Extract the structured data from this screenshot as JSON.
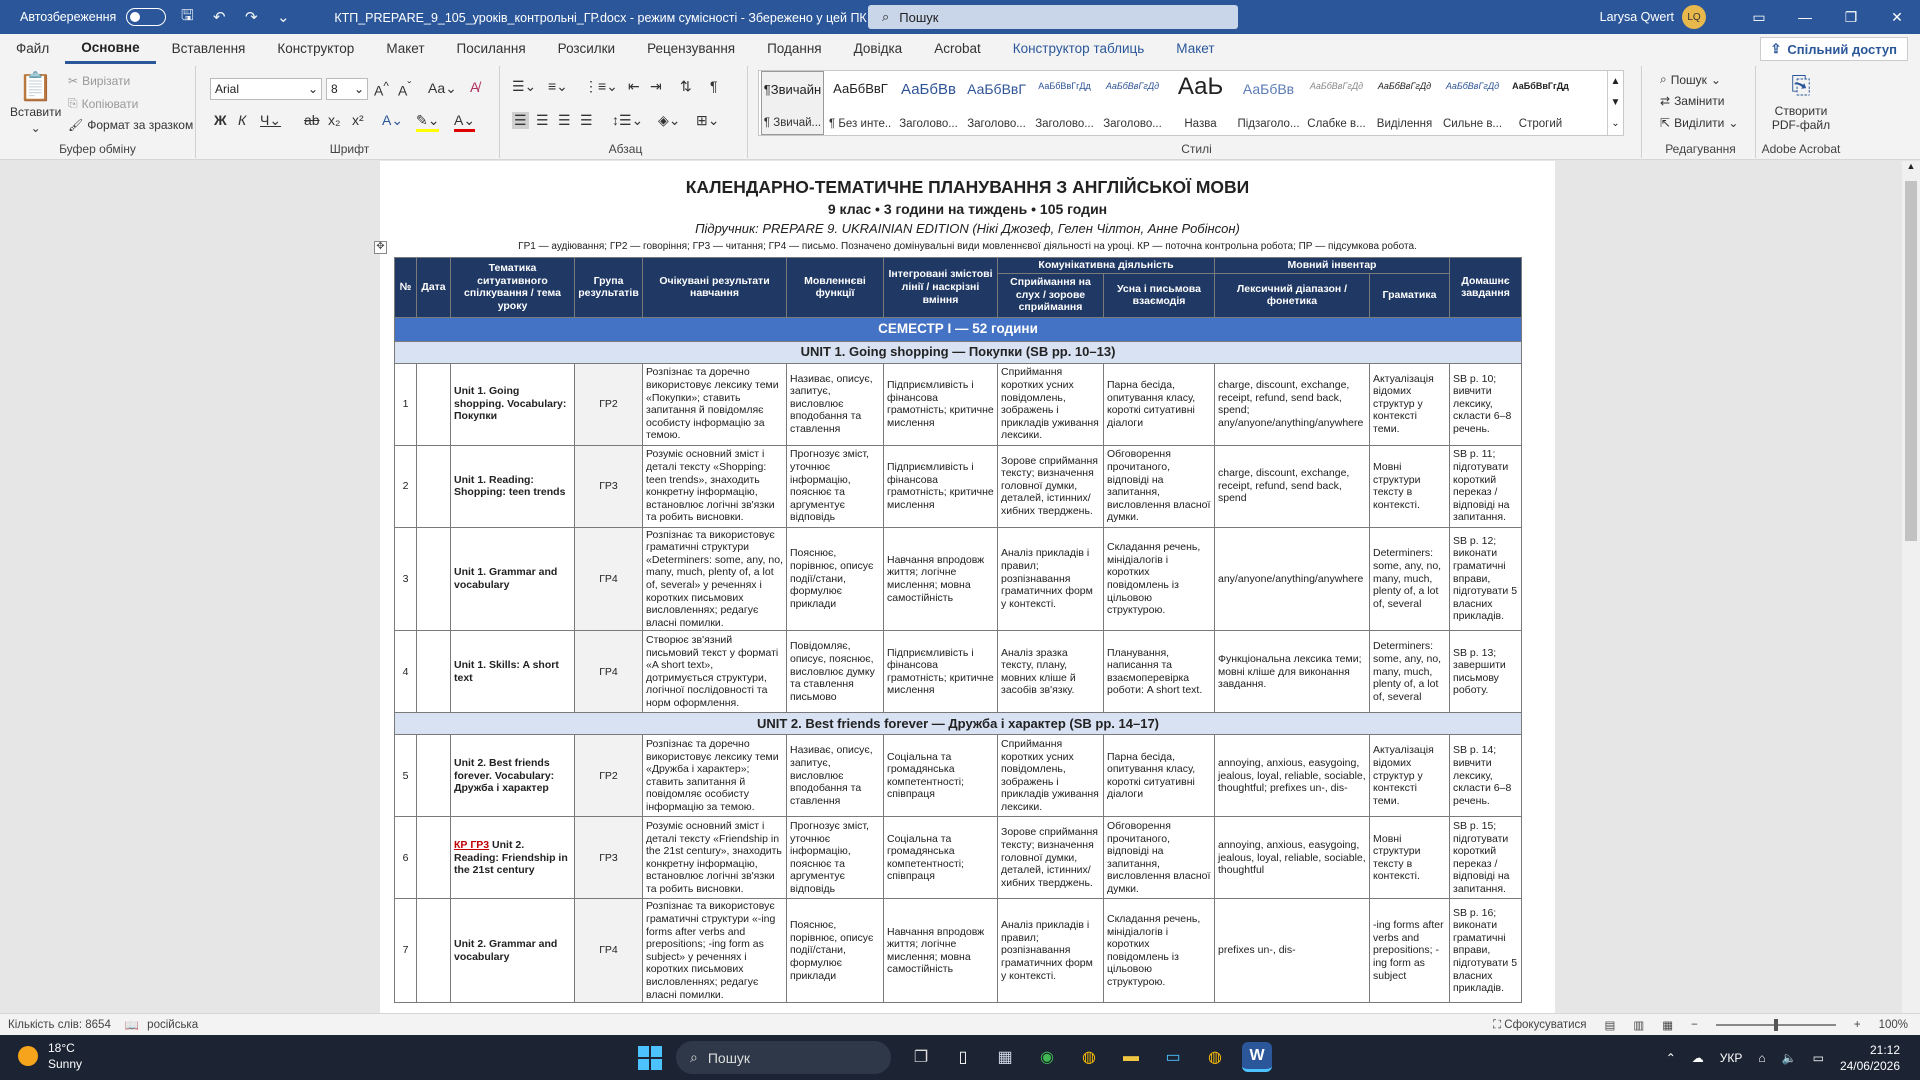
{
  "titlebar": {
    "autosave": "Автозбереження",
    "doc_title": "КТП_PREPARE_9_105_уроків_контрольні_ГР.docx  -  режим сумісності  -  Збережено у цей ПК  ⌄",
    "search": "Пошук",
    "user": "Larysa Qwert",
    "initials": "LQ"
  },
  "menu": {
    "tabs": [
      "Файл",
      "Основне",
      "Вставлення",
      "Конструктор",
      "Макет",
      "Посилання",
      "Розсилки",
      "Рецензування",
      "Подання",
      "Довідка",
      "Acrobat",
      "Конструктор таблиць",
      "Макет"
    ],
    "share": "Спільний доступ"
  },
  "ribbon": {
    "clipboard": {
      "label": "Буфер обміну",
      "paste": "Вставити",
      "cut": "Вирізати",
      "copy": "Копіювати",
      "format_painter": "Формат за зразком"
    },
    "font": {
      "label": "Шрифт",
      "family": "Arial",
      "size": "8"
    },
    "paragraph": {
      "label": "Абзац"
    },
    "styles": {
      "label": "Стилі",
      "items": [
        {
          "sample": "¶Звичайн",
          "name": "¶ Звичай..."
        },
        {
          "sample": "АаБбВвГ",
          "name": "¶ Без инте..."
        },
        {
          "sample": "АаБбВв",
          "name": "Заголово..."
        },
        {
          "sample": "АаБбВвГ",
          "name": "Заголово..."
        },
        {
          "sample": "АаБбВвГгДд",
          "name": "Заголово..."
        },
        {
          "sample": "АаБбВвГгДд",
          "name": "Заголово..."
        },
        {
          "sample": "АаЬ",
          "name": "Назва"
        },
        {
          "sample": "АаБбВв",
          "name": "Підзаголо..."
        },
        {
          "sample": "АаБбВвГгДд",
          "name": "Слабке в..."
        },
        {
          "sample": "АаБбВвГгДд",
          "name": "Виділення"
        },
        {
          "sample": "АаБбВвГгДд",
          "name": "Сильне в..."
        },
        {
          "sample": "АаБбВвГгДд",
          "name": "Строгий"
        }
      ]
    },
    "editing": {
      "label": "Редагування",
      "find": "Пошук",
      "replace": "Замінити",
      "select": "Виділити"
    },
    "acrobat": {
      "label": "Adobe Acrobat",
      "create_pdf": "Створити PDF-файл"
    }
  },
  "document": {
    "title": "КАЛЕНДАРНО-ТЕМАТИЧНЕ ПЛАНУВАННЯ З АНГЛІЙСЬКОЇ МОВИ",
    "subtitle": "9 клас • 3 години на тиждень • 105 годин",
    "textbook": "Підручник: PREPARE 9. UKRAINIAN EDITION (Нікі Джозеф, Гелен Чілтон, Анне Робінсон)",
    "legend": "ГР1 — аудіювання; ГР2 — говоріння; ГР3 — читання; ГР4 — письмо. Позначено домінувальні види мовленнєвої діяльності на уроці. КР — поточна контрольна робота; ПР — підсумкова робота.",
    "headers": {
      "no": "№",
      "date": "Дата",
      "topic": "Тематика ситуативного спілкування / тема уроку",
      "group": "Група результатів",
      "outcomes": "Очікувані результати навчання",
      "functions": "Мовленнєві функції",
      "integrated": "Інтегровані змістові лінії / наскрізні вміння",
      "comm": "Комунікативна діяльність",
      "listening": "Сприймання на слух / зорове сприймання",
      "oral": "Усна і письмова взаємодія",
      "lang": "Мовний інвентар",
      "lexis": "Лексичний діапазон / фонетика",
      "grammar": "Граматика",
      "homework": "Домашнє завдання"
    },
    "semester": "СЕМЕСТР І — 52 години",
    "unit1": "UNIT 1. Going shopping — Покупки (SB pp. 10–13)",
    "unit2": "UNIT 2. Best friends forever — Дружба і характер (SB pp. 14–17)",
    "rows": [
      {
        "no": "1",
        "kr": "",
        "topic": "Unit 1. Going shopping. Vocabulary: Покупки",
        "grp": "ГР2",
        "out": "Розпізнає та доречно використовує лексику теми «Покупки»; ставить запитання й повідомляє особисту інформацію за темою.",
        "func": "Називає, описує, запитує, висловлює вподобання та ставлення",
        "integ": "Підприємливість і фінансова грамотність; критичне мислення",
        "listen": "Сприймання коротких усних повідомлень, зображень і прикладів уживання лексики.",
        "oral": "Парна бесіда, опитування класу, короткі ситуативні діалоги",
        "lex": "charge, discount, exchange, receipt, refund, send back, spend; any/anyone/anything/anywhere",
        "gram": "Актуалізація відомих структур у контексті теми.",
        "hw": "SB p. 10; вивчити лексику, скласти 6–8 речень."
      },
      {
        "no": "2",
        "kr": "",
        "topic": "Unit 1. Reading: Shopping: teen trends",
        "grp": "ГР3",
        "out": "Розуміє основний зміст і деталі тексту «Shopping: teen trends», знаходить конкретну інформацію, встановлює логічні зв'язки та робить висновки.",
        "func": "Прогнозує зміст, уточнює інформацію, пояснює та аргументує відповідь",
        "integ": "Підприємливість і фінансова грамотність; критичне мислення",
        "listen": "Зорове сприймання тексту; визначення головної думки, деталей, істинних/хибних тверджень.",
        "oral": "Обговорення прочитаного, відповіді на запитання, висловлення власної думки.",
        "lex": "charge, discount, exchange, receipt, refund, send back, spend",
        "gram": "Мовні структури тексту в контексті.",
        "hw": "SB p. 11; підготувати короткий переказ / відповіді на запитання."
      },
      {
        "no": "3",
        "kr": "",
        "topic": "Unit 1. Grammar and vocabulary",
        "grp": "ГР4",
        "out": "Розпізнає та використовує граматичні структури «Determiners: some, any, no, many, much, plenty of, a lot of, several» у реченнях і коротких письмових висловленнях; редагує власні помилки.",
        "func": "Пояснює, порівнює, описує події/стани, формулює приклади",
        "integ": "Навчання впродовж життя; логічне мислення; мовна самостійність",
        "listen": "Аналіз прикладів і правил; розпізнавання граматичних форм у контексті.",
        "oral": "Складання речень, мінідіалогів і коротких повідомлень із цільовою структурою.",
        "lex": "any/anyone/anything/anywhere",
        "gram": "Determiners: some, any, no, many, much, plenty of, a lot of, several",
        "hw": "SB p. 12; виконати граматичні вправи, підготувати 5 власних прикладів."
      },
      {
        "no": "4",
        "kr": "",
        "topic": "Unit 1. Skills: A short text",
        "grp": "ГР4",
        "out": "Створює зв'язний письмовий текст у форматі «A short text», дотримується структури, логічної послідовності та норм оформлення.",
        "func": "Повідомляє, описує, пояснює, висловлює думку та ставлення письмово",
        "integ": "Підприємливість і фінансова грамотність; критичне мислення",
        "listen": "Аналіз зразка тексту, плану, мовних кліше й засобів зв'язку.",
        "oral": "Планування, написання та взаємоперевірка роботи: A short text.",
        "lex": "Функціональна лексика теми; мовні кліше для виконання завдання.",
        "gram": "Determiners: some, any, no, many, much, plenty of, a lot of, several",
        "hw": "SB p. 13; завершити письмову роботу."
      },
      {
        "no": "5",
        "kr": "",
        "topic": "Unit 2. Best friends forever. Vocabulary: Дружба і характер",
        "grp": "ГР2",
        "out": "Розпізнає та доречно використовує лексику теми «Дружба і характер»; ставить запитання й повідомляє особисту інформацію за темою.",
        "func": "Називає, описує, запитує, висловлює вподобання та ставлення",
        "integ": "Соціальна та громадянська компетентності; співпраця",
        "listen": "Сприймання коротких усних повідомлень, зображень і прикладів уживання лексики.",
        "oral": "Парна бесіда, опитування класу, короткі ситуативні діалоги",
        "lex": "annoying, anxious, easygoing, jealous, loyal, reliable, sociable, thoughtful; prefixes un-, dis-",
        "gram": "Актуалізація відомих структур у контексті теми.",
        "hw": "SB p. 14; вивчити лексику, скласти 6–8 речень."
      },
      {
        "no": "6",
        "kr": "КР ГР3",
        "topic": "Unit 2. Reading: Friendship in the 21st century",
        "grp": "ГР3",
        "out": "Розуміє основний зміст і деталі тексту «Friendship in the 21st century», знаходить конкретну інформацію, встановлює логічні зв'язки та робить висновки.",
        "func": "Прогнозує зміст, уточнює інформацію, пояснює та аргументує відповідь",
        "integ": "Соціальна та громадянська компетентності; співпраця",
        "listen": "Зорове сприймання тексту; визначення головної думки, деталей, істинних/хибних тверджень.",
        "oral": "Обговорення прочитаного, відповіді на запитання, висловлення власної думки.",
        "lex": "annoying, anxious, easygoing, jealous, loyal, reliable, sociable, thoughtful",
        "gram": "Мовні структури тексту в контексті.",
        "hw": "SB p. 15; підготувати короткий переказ / відповіді на запитання."
      },
      {
        "no": "7",
        "kr": "",
        "topic": "Unit 2. Grammar and vocabulary",
        "grp": "ГР4",
        "out": "Розпізнає та використовує граматичні структури «-ing forms after verbs and prepositions; -ing form as subject» у реченнях і коротких письмових висловленнях; редагує власні помилки.",
        "func": "Пояснює, порівнює, описує події/стани, формулює приклади",
        "integ": "Навчання впродовж життя; логічне мислення; мовна самостійність",
        "listen": "Аналіз прикладів і правил; розпізнавання граматичних форм у контексті.",
        "oral": "Складання речень, мінідіалогів і коротких повідомлень із цільовою структурою.",
        "lex": "prefixes un-, dis-",
        "gram": "-ing forms after verbs and prepositions; -ing form as subject",
        "hw": "SB p. 16; виконати граматичні вправи, підготувати 5 власних прикладів."
      }
    ]
  },
  "status": {
    "words": "Кількість слів: 8654",
    "lang": "російська",
    "focus": "Сфокусуватися",
    "zoom": "100%"
  },
  "taskbar": {
    "temp": "18°C",
    "weather": "Sunny",
    "search": "Пошук",
    "lang": "УКР",
    "time": "21:12",
    "date": "24/06/2026"
  }
}
